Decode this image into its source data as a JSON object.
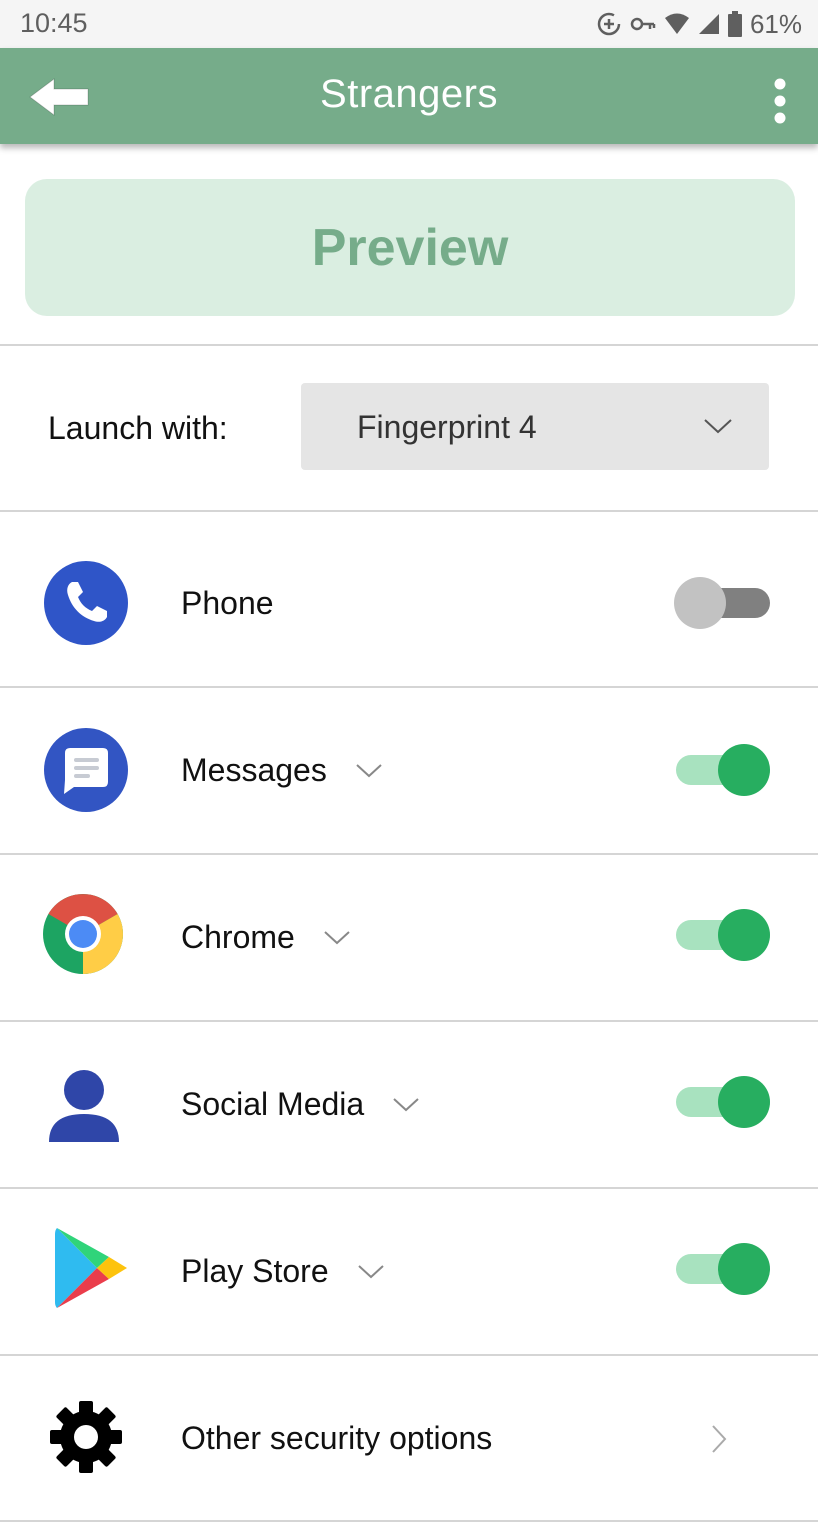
{
  "status_bar": {
    "time": "10:45",
    "battery": "61%",
    "icons": [
      "data-saver-icon",
      "vpn-key-icon",
      "wifi-icon",
      "cell-signal-icon",
      "battery-icon"
    ]
  },
  "app_bar": {
    "title": "Strangers",
    "back_icon": "back-arrow-icon",
    "menu_icon": "more-vert-icon",
    "color": "#76ac8a"
  },
  "preview": {
    "label": "Preview",
    "background": "#daeee1"
  },
  "launch": {
    "label": "Launch with:",
    "selected": "Fingerprint 4"
  },
  "apps": [
    {
      "label": "Phone",
      "icon": "phone-app-icon",
      "expandable": false,
      "enabled": false
    },
    {
      "label": "Messages",
      "icon": "messages-app-icon",
      "expandable": true,
      "enabled": true
    },
    {
      "label": "Chrome",
      "icon": "chrome-app-icon",
      "expandable": true,
      "enabled": true
    },
    {
      "label": "Social Media",
      "icon": "person-icon",
      "expandable": true,
      "enabled": true
    },
    {
      "label": "Play Store",
      "icon": "play-store-icon",
      "expandable": true,
      "enabled": true
    }
  ],
  "other_options": {
    "label": "Other security options",
    "icon": "gear-icon"
  },
  "colors": {
    "toggle_on_knob": "#27ae60",
    "toggle_on_track": "#a8e2bf",
    "toggle_off_knob": "#c2c2c2",
    "toggle_off_track": "#808080"
  }
}
